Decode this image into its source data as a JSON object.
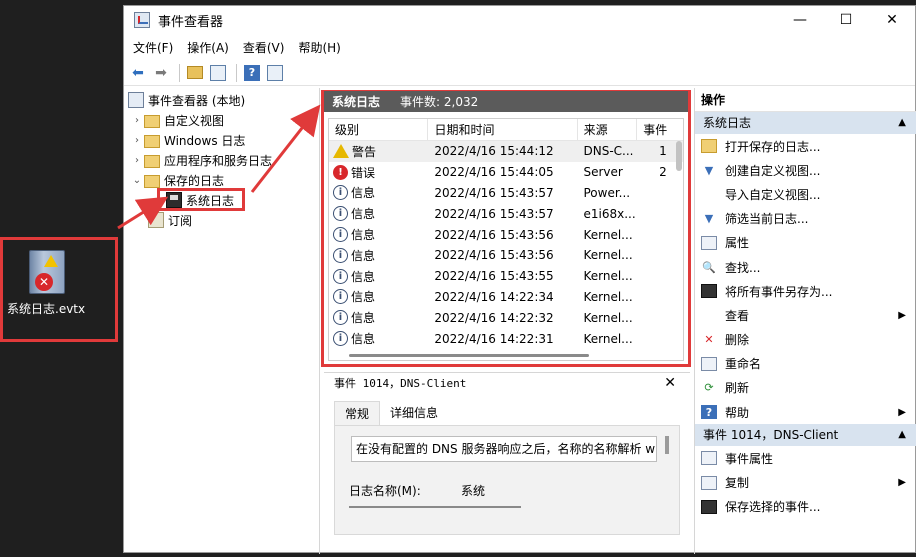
{
  "desktop": {
    "file_name": "系统日志.evtx"
  },
  "window": {
    "title": "事件查看器",
    "controls": {
      "minimize": "—",
      "maximize": "☐",
      "close": "✕"
    }
  },
  "menu": [
    "文件(F)",
    "操作(A)",
    "查看(V)",
    "帮助(H)"
  ],
  "tree": {
    "root": "事件查看器 (本地)",
    "items": [
      "自定义视图",
      "Windows 日志",
      "应用程序和服务日志",
      "保存的日志"
    ],
    "selected": "系统日志",
    "subscriptions": "订阅"
  },
  "log": {
    "title": "系统日志",
    "count": "事件数: 2,032",
    "columns": [
      "级别",
      "日期和时间",
      "来源",
      "事件"
    ],
    "rows": [
      {
        "level": "警告",
        "kind": "warn",
        "date": "2022/4/16 15:44:12",
        "source": "DNS-C...",
        "id": "1"
      },
      {
        "level": "错误",
        "kind": "err",
        "date": "2022/4/16 15:44:05",
        "source": "Server",
        "id": "2"
      },
      {
        "level": "信息",
        "kind": "info",
        "date": "2022/4/16 15:43:57",
        "source": "Power...",
        "id": ""
      },
      {
        "level": "信息",
        "kind": "info",
        "date": "2022/4/16 15:43:57",
        "source": "e1i68x...",
        "id": ""
      },
      {
        "level": "信息",
        "kind": "info",
        "date": "2022/4/16 15:43:56",
        "source": "Kernel...",
        "id": ""
      },
      {
        "level": "信息",
        "kind": "info",
        "date": "2022/4/16 15:43:56",
        "source": "Kernel...",
        "id": ""
      },
      {
        "level": "信息",
        "kind": "info",
        "date": "2022/4/16 15:43:55",
        "source": "Kernel...",
        "id": ""
      },
      {
        "level": "信息",
        "kind": "info",
        "date": "2022/4/16 14:22:34",
        "source": "Kernel...",
        "id": ""
      },
      {
        "level": "信息",
        "kind": "info",
        "date": "2022/4/16 14:22:32",
        "source": "Kernel...",
        "id": ""
      },
      {
        "level": "信息",
        "kind": "info",
        "date": "2022/4/16 14:22:31",
        "source": "Kernel...",
        "id": ""
      }
    ]
  },
  "detail": {
    "title": "事件 1014，DNS-Client",
    "close": "✕",
    "tabs": [
      "常规",
      "详细信息"
    ],
    "message": "在没有配置的 DNS 服务器响应之后，名称的名称解析 wp",
    "log_name_label": "日志名称(M):",
    "log_name_value": "系统"
  },
  "actions": {
    "header": "操作",
    "group1": "系统日志",
    "group1_items": [
      "打开保存的日志...",
      "创建自定义视图...",
      "导入自定义视图...",
      "筛选当前日志...",
      "属性",
      "查找...",
      "将所有事件另存为...",
      "查看",
      "删除",
      "重命名",
      "刷新",
      "帮助"
    ],
    "group2": "事件 1014，DNS-Client",
    "group2_items": [
      "事件属性",
      "复制",
      "保存选择的事件..."
    ]
  },
  "colors": {
    "highlight": "#e03a3a",
    "group_bg": "#d8e3ef",
    "header_bg": "#5b5b5b"
  }
}
